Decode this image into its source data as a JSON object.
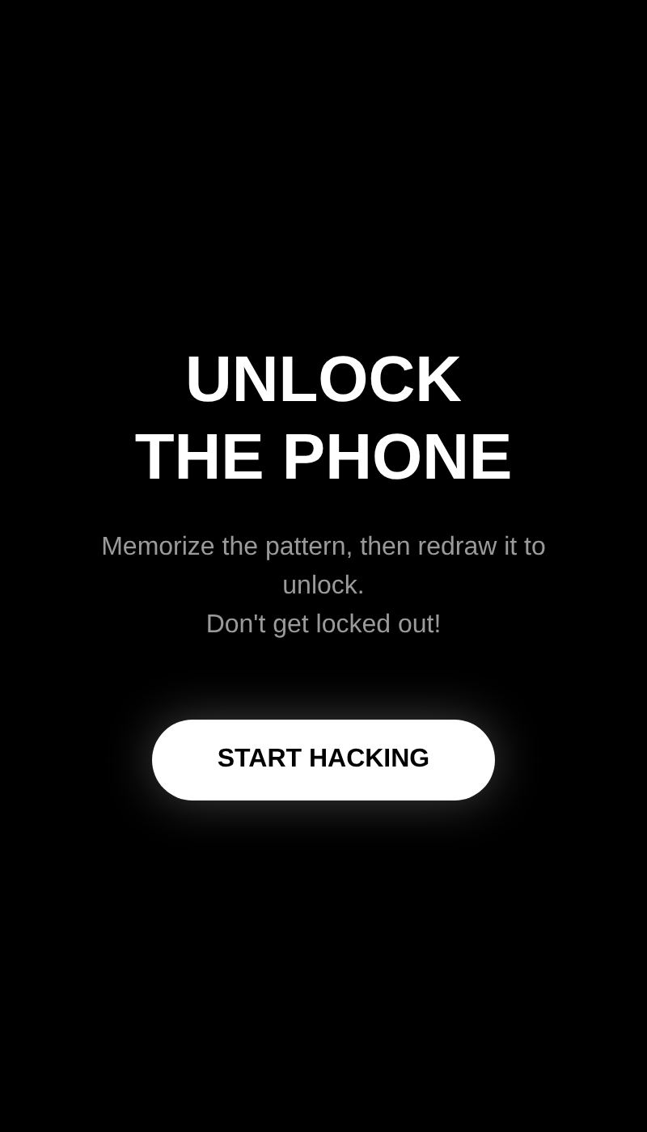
{
  "title_lines": [
    "UNLOCK",
    "THE PHONE"
  ],
  "description": [
    "Memorize the pattern, then redraw it to unlock.",
    "Don't get locked out!"
  ],
  "start_button": {
    "label": "START HACKING"
  }
}
